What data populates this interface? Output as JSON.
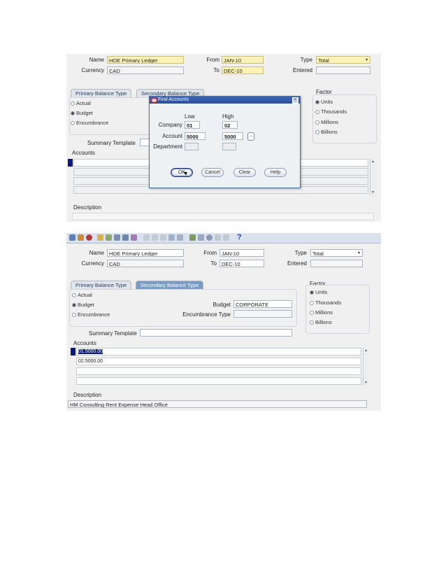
{
  "top": {
    "header": {
      "name_label": "Name",
      "name_value": "HOE Primary Ledger",
      "currency_label": "Currency",
      "currency_value": "CAD",
      "from_label": "From",
      "from_value": "JAN-10",
      "to_label": "To",
      "to_value": "DEC-10",
      "type_label": "Type",
      "type_value": "Total",
      "entered_label": "Entered",
      "entered_value": ""
    },
    "tabs": [
      "Primary Balance Type",
      "Secondary Balance Type"
    ],
    "balance_types": [
      "Actual",
      "Budget",
      "Encumbrance"
    ],
    "summary_template_label": "Summary Template",
    "accounts_label": "Accounts",
    "description_label": "Description",
    "factor": {
      "label": "Factor",
      "options": [
        "Units",
        "Thousands",
        "Millions",
        "Billions"
      ]
    },
    "dialog": {
      "title": "Find Accounts",
      "low_label": "Low",
      "high_label": "High",
      "rows": [
        {
          "label": "Company",
          "low": "01",
          "high": "02"
        },
        {
          "label": "Account",
          "low": "5000",
          "high": "5000"
        },
        {
          "label": "Department",
          "low": "",
          "high": ""
        }
      ],
      "buttons": {
        "ok": "OK",
        "cancel": "Cancel",
        "clear": "Clear",
        "help": "Help"
      }
    }
  },
  "bottom": {
    "toolbar": {
      "help_icon": "?"
    },
    "header": {
      "name_label": "Name",
      "name_value": "HOE Primary Ledger",
      "currency_label": "Currency",
      "currency_value": "CAD",
      "from_label": "From",
      "from_value": "JAN-10",
      "to_label": "To",
      "to_value": "DEC-10",
      "type_label": "Type",
      "type_value": "Total",
      "entered_label": "Entered",
      "entered_value": ""
    },
    "tabs": [
      "Primary Balance Type",
      "Secondary Balance Type"
    ],
    "balance_types": [
      "Actual",
      "Budget",
      "Encumbrance"
    ],
    "budget_label": "Budget",
    "budget_value": "CORPORATE",
    "encumbrance_type_label": "Encumbrance Type",
    "encumbrance_type_value": "",
    "summary_template_label": "Summary Template",
    "accounts_label": "Accounts",
    "accounts": [
      "01.5000.00",
      "02.5000.00",
      "",
      ""
    ],
    "description_label": "Description",
    "description_value": "HM Consulting Rent Expense Head Office",
    "factor": {
      "label": "Factor",
      "options": [
        "Units",
        "Thousands",
        "Millions",
        "Billions"
      ]
    }
  }
}
